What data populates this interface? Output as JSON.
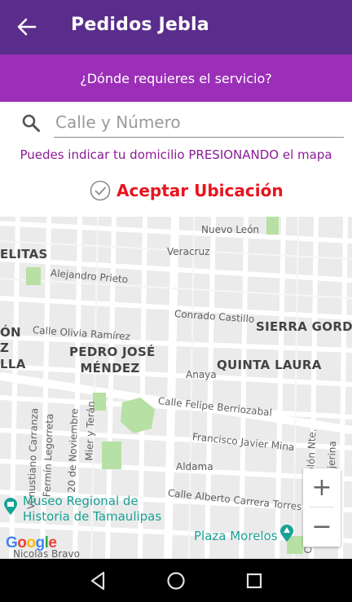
{
  "appbar": {
    "title": "Pedidos Jebla",
    "back_icon": "arrow-left-icon"
  },
  "subbar": {
    "question": "¿Dónde requieres el servicio?"
  },
  "search": {
    "placeholder": "Calle y Número",
    "value": "",
    "icon": "search-icon"
  },
  "hint": "Puedes indicar tu domicilio PRESIONANDO el mapa",
  "accept": {
    "label": "Aceptar Ubicación",
    "icon": "check-circle-icon"
  },
  "map": {
    "streets": [
      "Nuevo León",
      "Veracruz",
      "Alejandro Prieto",
      "Conrado Castillo",
      "Calle Olivia Ramírez",
      "Anaya",
      "Calle Felipe Berriozabal",
      "Francisco Javier Mina",
      "Aldama",
      "Calle Alberto Carrera Torres",
      "Nicolas Bravo",
      "Venustiano Carranza",
      "Fermín Legorreta",
      "20 de Noviembre",
      "Mier y Terán",
      "Calle Cristóbal Colón Nte.",
      "Calle Juan B. Tijerina"
    ],
    "neighborhoods": [
      "ELITAS",
      "ÓN",
      "Z",
      "LLA",
      "PEDRO JOSÉ",
      "MÉNDEZ",
      "QUINTA LAURA",
      "SIERRA GORDA"
    ],
    "pois": [
      "Museo Regional de",
      "Historia de Tamaulipas",
      "Plaza Morelos"
    ],
    "zoom_in": "+",
    "zoom_out": "−",
    "logo": [
      "G",
      "o",
      "o",
      "g",
      "l",
      "e"
    ],
    "logo_colors": [
      "#4285F4",
      "#EA4335",
      "#FBBC05",
      "#4285F4",
      "#34A853",
      "#EA4335"
    ]
  },
  "navbar": {
    "back": "back-triangle-icon",
    "home": "home-circle-icon",
    "recents": "recents-square-icon"
  },
  "colors": {
    "appbar": "#5a2d8c",
    "subbar": "#9b2fb8",
    "hint": "#8a1c95",
    "accept": "#e8141e",
    "poi": "#1aa195"
  }
}
